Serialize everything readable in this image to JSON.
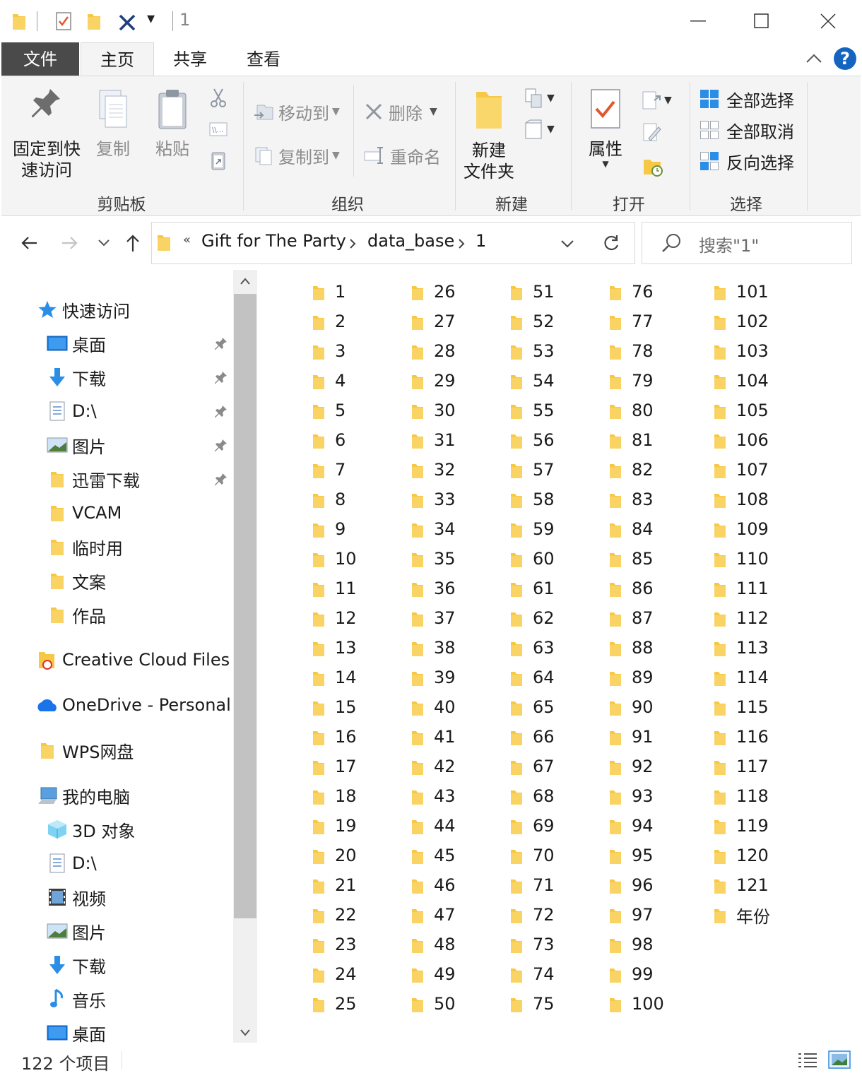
{
  "window": {
    "title": "1",
    "quick_access_sep": "|",
    "dropdown": "▾"
  },
  "ribbon_tabs": [
    "文件",
    "主页",
    "共享",
    "查看"
  ],
  "ribbon": {
    "clipboard": {
      "pin_label": [
        "固定到快",
        "速访问"
      ],
      "copy": "复制",
      "paste": "粘贴",
      "group": "剪贴板"
    },
    "organize": {
      "move_to": "移动到",
      "copy_to": "复制到",
      "delete": "删除",
      "rename": "重命名",
      "group": "组织"
    },
    "new": {
      "new_folder": [
        "新建",
        "文件夹"
      ],
      "group": "新建"
    },
    "open": {
      "properties": "属性",
      "group": "打开"
    },
    "select": {
      "select_all": "全部选择",
      "select_none": "全部取消",
      "invert": "反向选择",
      "group": "选择"
    }
  },
  "address": {
    "chevron": "«",
    "crumbs": [
      "Gift for The Party",
      "data_base",
      "1"
    ],
    "search_placeholder": "搜索\"1\""
  },
  "nav": {
    "quick_access": "快速访问",
    "quick_items": [
      {
        "label": "桌面",
        "icon": "desktop-icon",
        "pinned": true
      },
      {
        "label": "下载",
        "icon": "download-icon",
        "pinned": true
      },
      {
        "label": "D:\\",
        "icon": "drive-doc-icon",
        "pinned": true
      },
      {
        "label": "图片",
        "icon": "pictures-icon",
        "pinned": true
      },
      {
        "label": "迅雷下载",
        "icon": "folder-icon",
        "pinned": true
      },
      {
        "label": "VCAM",
        "icon": "folder-icon",
        "pinned": false
      },
      {
        "label": "临时用",
        "icon": "folder-icon",
        "pinned": false
      },
      {
        "label": "文案",
        "icon": "folder-icon",
        "pinned": false
      },
      {
        "label": "作品",
        "icon": "folder-icon",
        "pinned": false
      }
    ],
    "creative_cloud": "Creative Cloud Files",
    "onedrive": "OneDrive - Personal",
    "wps": "WPS网盘",
    "this_pc": "我的电脑",
    "pc_items": [
      {
        "label": "3D 对象",
        "icon": "3d-objects-icon"
      },
      {
        "label": "D:\\",
        "icon": "drive-doc-icon"
      },
      {
        "label": "视频",
        "icon": "videos-icon"
      },
      {
        "label": "图片",
        "icon": "pictures-icon"
      },
      {
        "label": "下载",
        "icon": "download-icon"
      },
      {
        "label": "音乐",
        "icon": "music-icon"
      },
      {
        "label": "桌面",
        "icon": "desktop-icon"
      }
    ]
  },
  "files": [
    "1",
    "2",
    "3",
    "4",
    "5",
    "6",
    "7",
    "8",
    "9",
    "10",
    "11",
    "12",
    "13",
    "14",
    "15",
    "16",
    "17",
    "18",
    "19",
    "20",
    "21",
    "22",
    "23",
    "24",
    "25",
    "26",
    "27",
    "28",
    "29",
    "30",
    "31",
    "32",
    "33",
    "34",
    "35",
    "36",
    "37",
    "38",
    "39",
    "40",
    "41",
    "42",
    "43",
    "44",
    "45",
    "46",
    "47",
    "48",
    "49",
    "50",
    "51",
    "52",
    "53",
    "54",
    "55",
    "56",
    "57",
    "58",
    "59",
    "60",
    "61",
    "62",
    "63",
    "64",
    "65",
    "66",
    "67",
    "68",
    "69",
    "70",
    "71",
    "72",
    "73",
    "74",
    "75",
    "76",
    "77",
    "78",
    "79",
    "80",
    "81",
    "82",
    "83",
    "84",
    "85",
    "86",
    "87",
    "88",
    "89",
    "90",
    "91",
    "92",
    "93",
    "94",
    "95",
    "96",
    "97",
    "98",
    "99",
    "100",
    "101",
    "102",
    "103",
    "104",
    "105",
    "106",
    "107",
    "108",
    "109",
    "110",
    "111",
    "112",
    "113",
    "114",
    "115",
    "116",
    "117",
    "118",
    "119",
    "120",
    "121",
    "年份"
  ],
  "status": {
    "item_count": "122 个项目"
  },
  "colors": {
    "file_tab_bg": "#4a4a4a",
    "folder": "#f7c843",
    "accent": "#1a73e8",
    "help": "#1565c0"
  }
}
